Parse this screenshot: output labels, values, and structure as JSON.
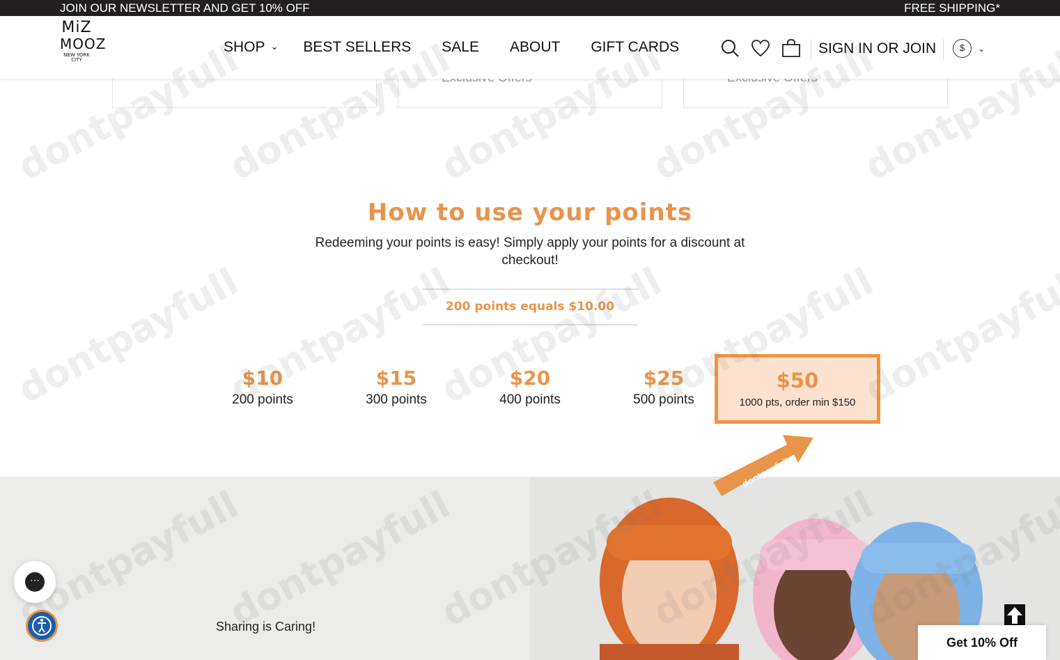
{
  "announcement": {
    "left": "JOIN OUR NEWSLETTER AND GET 10% OFF",
    "right": "FREE SHIPPING*"
  },
  "header": {
    "logo": {
      "line1": "MiZ",
      "line2": "MOOZ",
      "line3": "NEW YORK CITY"
    },
    "nav": [
      "SHOP",
      "BEST SELLERS",
      "SALE",
      "ABOUT",
      "GIFT CARDS"
    ],
    "signin": "SIGN IN OR JOIN",
    "currency": "$",
    "icons": [
      "search-icon",
      "heart-icon",
      "cart-icon"
    ]
  },
  "cards": {
    "offer_text": "Exclusive Offers"
  },
  "howto": {
    "title": "How to use your points",
    "subtitle": "Redeeming your points is easy! Simply apply your points for a discount at checkout!",
    "rate": "200 points equals $10.00",
    "tiers": [
      {
        "amount": "$10",
        "points": "200 points"
      },
      {
        "amount": "$15",
        "points": "300 points"
      },
      {
        "amount": "$20",
        "points": "400 points"
      },
      {
        "amount": "$25",
        "points": "500 points"
      },
      {
        "amount": "$50",
        "points": "1000 pts, order min $150"
      }
    ],
    "active_tier": 4
  },
  "bottom": {
    "sharing": "Sharing is Caring!"
  },
  "widgets": {
    "discount": "Get 10% Off"
  },
  "watermark": "dontpayfull",
  "colors": {
    "accent": "#e8944a",
    "active_border": "#f0953f",
    "active_bg": "#fde3cf",
    "announce_bg": "#231f20"
  }
}
